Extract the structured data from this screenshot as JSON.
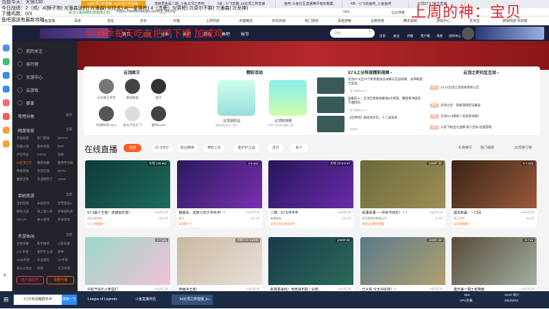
{
  "overlay": {
    "lines": [
      "当前今天：大师130",
      "今日战绩：2（鸡）4(狮子狗) 3(潘森送的) 2(潘森) 6(拉夫) 4(一星男枪) 4（洗鹿）5(男枪) 2(卓尔不群) 7(潘森) 2(龙神)",
      "下播鸡数：0/3",
      "鱼吧漏送有最新攻略"
    ],
    "top_red": "上周的神：宝贝",
    "mid_red": "新赛季每天吃五把鸡下播  加减鸡"
  },
  "tabs": [
    "lol云顶之弈直播_lol云顶之弈直播",
    "李麻君金属二期_斗鱼云顶之弈吧",
    "NB - 小飞直播_lol云顶之弈直播",
    "鱼吧-斗鱼社区直播精评者的聚集",
    "NB - 小飞的鱼吧_斗鱼鱼吧",
    "云顶S7.5 [官方直播"
  ],
  "address": {
    "company": "武汉斗鱼网络科技有限公司",
    "url": "https://www.douyu.com/g_ydzhy",
    "zoom": "95%",
    "search": "在此搜索"
  },
  "bookmarks": [
    "斗鱼直播",
    "百度",
    "淘宝",
    "京东",
    "天猫",
    "上网导航",
    "天猫精选",
    "京东商城",
    "热门游戏",
    "百度搜索",
    "企鹅电竞",
    "腾讯视频",
    "游戏中心",
    "爱淘宝",
    "骑侠网游 所有制"
  ],
  "header": {
    "logo": "斗鱼",
    "nav": [
      "首页",
      "直播",
      "分类",
      "鱼吧",
      "游戏",
      "鱼吧",
      "秋节"
    ],
    "search_placeholder": "搜索",
    "icons": [
      "历史",
      "关注",
      "开播",
      "客户端",
      "消息",
      "创作中心"
    ]
  },
  "sidebar": {
    "items": [
      "我的关注",
      "排行榜",
      "页游中心",
      "云游戏",
      "赛事"
    ],
    "sections": [
      {
        "title": "常用分类",
        "more": "展开",
        "games": []
      },
      {
        "title": "网游竞技",
        "more": "全部",
        "games": [
          "英雄联盟",
          "热门游戏",
          "DOTA2",
          "穿越火线",
          "腿本穿越",
          "DNF",
          "炉石传说",
          "CSGO",
          "逃跑",
          "lol云顶之弈",
          "魔兽争霸",
          "魔兽怀旧服",
          "传奇游戏",
          "守望先锋",
          "DOTA",
          "魔兽世界",
          "天涯明月刀",
          "APEX"
        ]
      },
      {
        "title": "单机热游",
        "more": "全部",
        "games": [
          "主机游戏",
          "永劫无间",
          "生死狙击2",
          "植物大战",
          "海上狼人杀",
          "逃离塔科夫",
          "VRAJX",
          "格斗游戏",
          "怀旧游戏"
        ]
      },
      {
        "title": "手游休闲",
        "more": "全部",
        "games": [
          "王者荣耀",
          "和平精英",
          "火影忍者",
          "LOL手游",
          "金铲铲之战",
          "原神",
          "COD手游",
          "幸运冒险",
          "CF手游",
          "双头斗地主",
          "鸡鸡",
          "天刀手游"
        ]
      }
    ],
    "btn_client": "客户端打开",
    "btn_live": "我要开播"
  },
  "panel": {
    "col1": {
      "title": "云顶疯王",
      "streamers": [
        "山东枫王菲菲",
        "躲猫躲猫",
        "猴子",
        "阿满枚月Carry",
        "鱼丸卡米东飞",
        "董伟koroh"
      ]
    },
    "col2": {
      "title": "精彩活动",
      "items": [
        "云顶进阶站",
        "云顶软妹榜"
      ],
      "subs": [
        "温和地板 宝贝一把刀",
        "云顶S7.5的选手最新上榜"
      ]
    },
    "col3": {
      "title": "S7.5上分阵容精彩视频 ›",
      "videos": [
        {
          "t": "云顶S7.5全24个新英雄攻击详解与实战效果，龙神联盟大显战",
          "a": "电子竞技bonTu"
        },
        {
          "t": "国服前十：云顶王者版本最强6大阵容，攀登者冲级百万遍回归",
          "a": "电子竞技bonTu"
        },
        {
          "t": "【迈特场】振碎冰外红，十二波波攻",
          "a": "迈特场"
        }
      ]
    },
    "col4": {
      "title": "云顶之弈社区互动 ›",
      "posts": [
        "12.17云顶之弈版本更新公告",
        "云顶之弈：隐秘海域玩法概览",
        "云顶S7.5来啦！抢投吧攻略！",
        "三星飞机出九金鳞 第八出局 拉锯游戏"
      ],
      "tag": "热帖"
    }
  },
  "live": {
    "title": "在线直播",
    "filters": [
      "全部",
      "S7.5冲分",
      "职业精英",
      "带粉上车",
      "金铲铲之战",
      "星升",
      "新人"
    ],
    "right": [
      "礼物排行",
      "热门视频",
      "云顶排行榜"
    ],
    "cards": [
      {
        "title": "S7.5最十王者！双镜俱乐部！",
        "cat": "lol云顶之弈",
        "author": "吕阳-凯鸣他",
        "hot": "126.3万",
        "badge": "大师 145 ♦62",
        "tag": "S4-S7最强第一",
        "c1": "#0e3a3a",
        "c2": "#1d6b5c"
      },
      {
        "title": "鹏版本，龙族小天才冲冲冲！！",
        "cat": "lol云顶之弈",
        "author": "猴子",
        "hot": "193.7万",
        "badge": "4-5 ♦41",
        "tag": "云顶第一人",
        "c1": "#2a1a5e",
        "c2": "#7a2fb0"
      },
      {
        "title": "二档：S7.5冲冲冲",
        "cat": "lol云顶之弈",
        "author": "躲猫躲猫",
        "hot": "141.2万",
        "badge": "大师 33 5-6 ♦7",
        "tag": "云顶之弈全球总冠军",
        "c1": "#24185a",
        "c2": "#6c2aa8"
      },
      {
        "title": "来蒲来蒲~~~中秋节快乐！！！",
        "cat": "lol云顶之弈",
        "author": "老张雷都的躲雷云顶",
        "hot": "67.5万",
        "badge": "1080P 30",
        "tag": "登场云顶黄金荣耀",
        "c1": "#6b6a3a",
        "c2": "#9c8f55"
      },
      {
        "title": "版本新赢：一口闷",
        "cat": "lol云顶之弈",
        "author": "疯王学哥",
        "hot": "64.8万",
        "badge": "5-2 ♦28",
        "tag": "云顶游戏霸子",
        "c1": "#3a2418",
        "c2": "#9a5a3a"
      },
      {
        "title": "中秋节快乐小笨蛋们",
        "cat": "lol云顶之弈",
        "author": "",
        "hot": "",
        "badge": "3-7 ♦56",
        "tag": "",
        "c1": "#9ad8c8",
        "c2": "#f0c0d8"
      },
      {
        "title": "伸雨冲王者！",
        "cat": "lol云顶之弈",
        "author": "",
        "hot": "",
        "badge": "大师 0 2-3 ♦100",
        "tag": "",
        "c1": "#c8b8a0",
        "c2": "#e8e0d8"
      },
      {
        "title": "新赛季来啦！电竞抹布胜！好想...",
        "cat": "lol云顶之弈",
        "author": "",
        "hot": "",
        "badge": "1080P 60",
        "tag": "",
        "c1": "#1a3a4a",
        "c2": "#2a6a5a"
      },
      {
        "title": "已大师 今天冲宗师！！",
        "cat": "lol云顶之弈",
        "author": "",
        "hot": "",
        "badge": "1080P 60",
        "tag": "",
        "c1": "#5a7a8a",
        "c2": "#b0a070"
      },
      {
        "title": "重庆第一钢王者降教",
        "cat": "lol云顶之弈",
        "author": "",
        "hot": "",
        "badge": "3-7 ♦1",
        "tag": "",
        "c1": "#5a4a3a",
        "c2": "#a0b0a0"
      }
    ]
  },
  "taskbar": {
    "search": "3.1万年前戴胜手术",
    "search_btn": "搜索一下",
    "apps": [
      "League of Legends",
      "斗鱼直播伴侣",
      "lol云顶之弈直播_lo..."
    ],
    "cpu": "18%",
    "cpu_label": "CPU负载",
    "time": "19:37 周六",
    "date": "2022/9/10"
  },
  "colors": {
    "accent": "#ff5d23",
    "header": "#1c1f3a",
    "sidebar": "#23242b",
    "overlay_red": "#e3262a"
  }
}
